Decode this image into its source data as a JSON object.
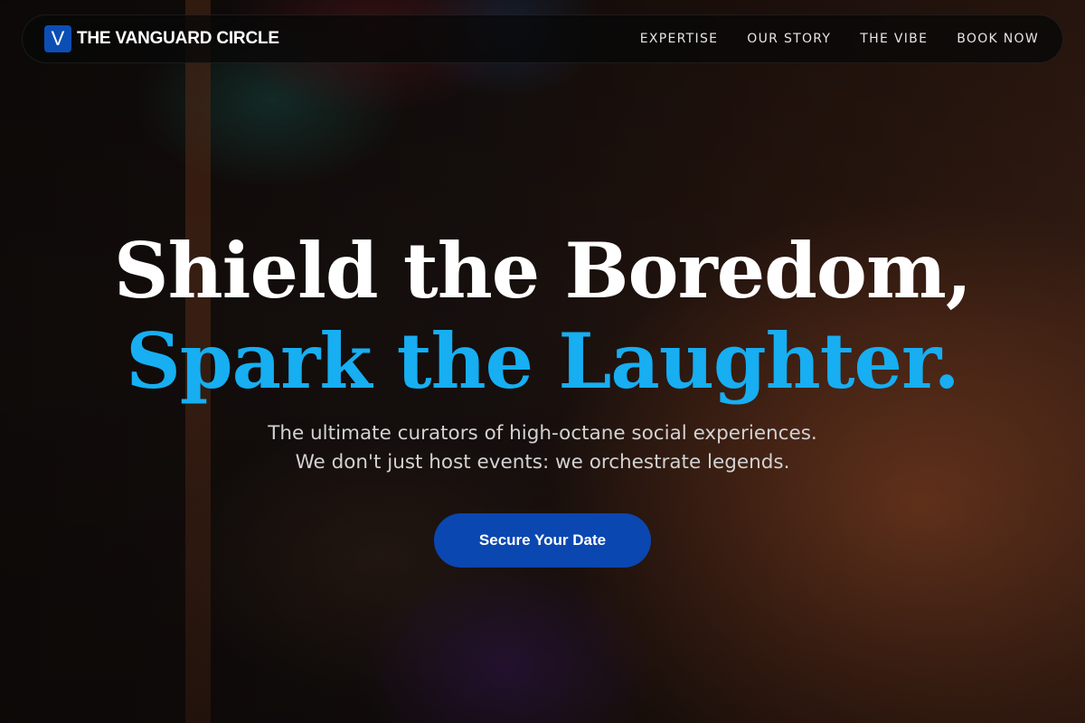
{
  "brand": {
    "mark": "V",
    "name": "THE VANGUARD CIRCLE"
  },
  "nav": {
    "items": [
      {
        "label": "EXPERTISE"
      },
      {
        "label": "OUR STORY"
      },
      {
        "label": "THE VIBE"
      },
      {
        "label": "BOOK NOW"
      }
    ]
  },
  "hero": {
    "headline_line1": "Shield the Boredom,",
    "headline_line2": "Spark the Laughter.",
    "subtitle_line1": "The ultimate curators of high-octane social experiences.",
    "subtitle_line2": "We don't just host events: we orchestrate legends.",
    "cta_label": "Secure Your Date"
  },
  "colors": {
    "accent": "#17aef2",
    "brand_blue": "#0b47b0",
    "nav_bg": "#080808"
  }
}
